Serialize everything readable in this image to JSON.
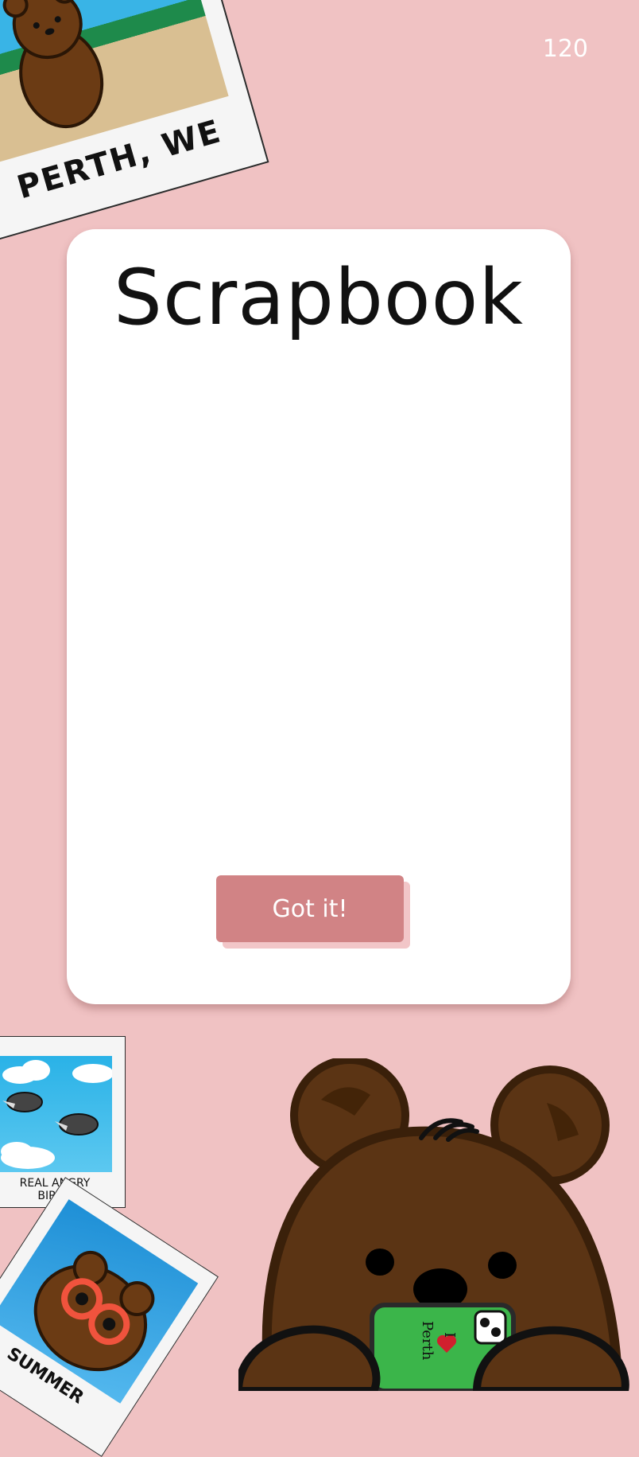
{
  "counter": "120",
  "polaroids": {
    "perth_caption": "PERTH, WE",
    "birds_caption_line1": "REAL ANGRY",
    "birds_caption_line2": "BIRDS",
    "summer_caption": "SUMMER"
  },
  "card": {
    "title": "Scrapbook",
    "button_label": "Got it!"
  },
  "phone": {
    "text_i": "I",
    "text_perth": "Perth"
  },
  "colors": {
    "background": "#f0c2c3",
    "button": "#d18385",
    "bear_fur": "#5b3414"
  }
}
